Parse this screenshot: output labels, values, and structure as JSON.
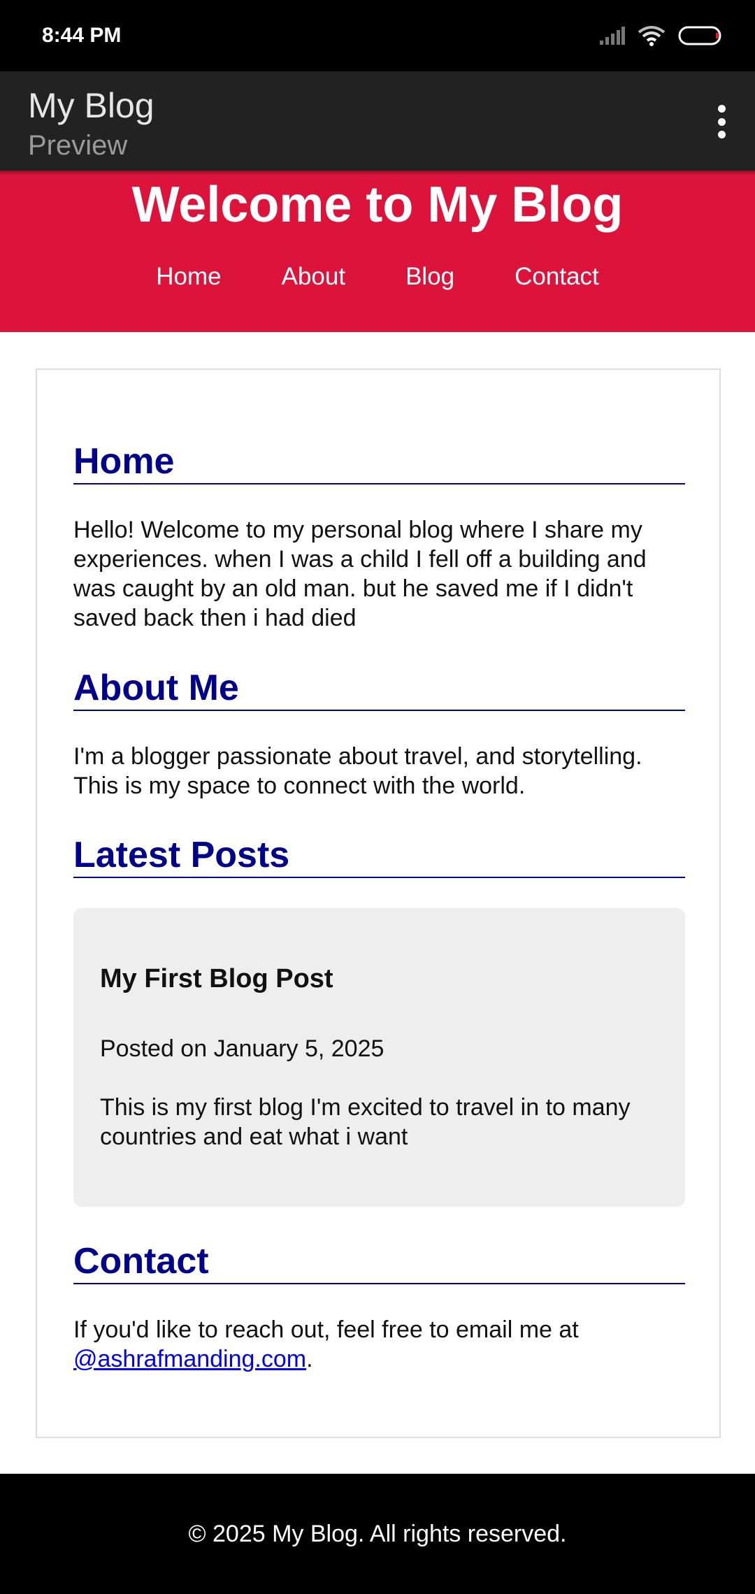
{
  "status_bar": {
    "time": "8:44 PM"
  },
  "app_bar": {
    "title": "My Blog",
    "subtitle": "Preview"
  },
  "hero": {
    "title": "Welcome to My Blog"
  },
  "nav": {
    "items": [
      "Home",
      "About",
      "Blog",
      "Contact"
    ]
  },
  "sections": {
    "home": {
      "heading": "Home",
      "text": "Hello! Welcome to my personal blog where I share my experiences. when I was a child I fell off a building and was caught by an old man. but he saved me if I didn't saved back then i had died"
    },
    "about": {
      "heading": "About Me",
      "text": "I'm a blogger passionate about travel, and storytelling. This is my space to connect with the world."
    },
    "posts": {
      "heading": "Latest Posts",
      "items": [
        {
          "title": "My First Blog Post",
          "date": "Posted on January 5, 2025",
          "body": "This is my first blog I'm excited to travel in to many countries and eat what i want"
        }
      ]
    },
    "contact": {
      "heading": "Contact",
      "text_before": "If you'd like to reach out, feel free to email me at ",
      "email": "@ashrafmanding.com",
      "text_after": "."
    }
  },
  "footer": {
    "text": "© 2025 My Blog. All rights reserved."
  },
  "colors": {
    "accent": "#DC143C",
    "heading": "#00008B",
    "appbar": "#222222"
  }
}
